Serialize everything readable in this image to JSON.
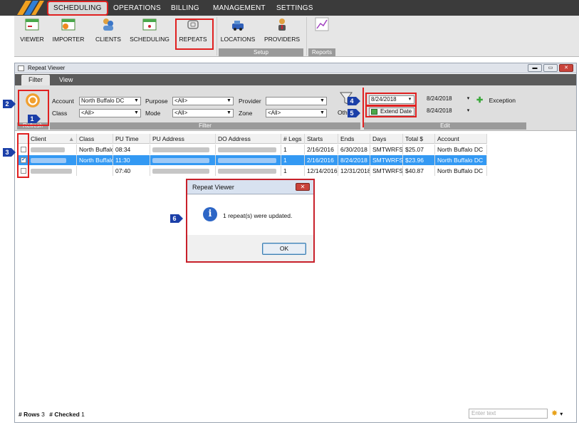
{
  "menu": {
    "items": [
      "SCHEDULING",
      "OPERATIONS",
      "BILLING",
      "MANAGEMENT",
      "SETTINGS"
    ]
  },
  "ribbon": {
    "buttons": [
      "VIEWER",
      "IMPORTER",
      "CLIENTS",
      "SCHEDULING",
      "REPEATS",
      "LOCATIONS",
      "PROVIDERS"
    ],
    "groups": {
      "setup": "Setup",
      "reports": "Reports"
    }
  },
  "window": {
    "title": "Repeat Viewer",
    "tabs": [
      "Filter",
      "View"
    ],
    "refresh_label": "Refresh",
    "filter_group_label": "Filter",
    "edit_group_label": "Edit",
    "fields": {
      "account_label": "Account",
      "account_value": "North Buffalo DC",
      "class_label": "Class",
      "class_value": "<All>",
      "purpose_label": "Purpose",
      "purpose_value": "<All>",
      "mode_label": "Mode",
      "mode_value": "<All>",
      "provider_label": "Provider",
      "provider_value": "",
      "zone_label": "Zone",
      "zone_value": "<All>",
      "other_label": "Other"
    },
    "edit": {
      "date1": "8/24/2018",
      "date2": "8/24/2018",
      "date3": "8/24/2018",
      "extend_label": "Extend Date",
      "exception_label": "Exception"
    }
  },
  "grid": {
    "headers": [
      "Client",
      "Class",
      "PU Time",
      "PU Address",
      "DO Address",
      "# Legs",
      "Starts",
      "Ends",
      "Days",
      "Total $",
      "Account"
    ],
    "rows": [
      {
        "checked": false,
        "class": "North Buffalo",
        "pu_time": "08:34",
        "legs": "1",
        "starts": "2/16/2016",
        "ends": "6/30/2018",
        "days": "SMTWRFS",
        "total": "$25.07",
        "account": "North Buffalo DC"
      },
      {
        "checked": true,
        "class": "North Buffalo",
        "pu_time": "11:30",
        "legs": "1",
        "starts": "2/16/2016",
        "ends": "8/24/2018",
        "days": "SMTWRFS",
        "total": "$23.96",
        "account": "North Buffalo DC"
      },
      {
        "checked": false,
        "class": "",
        "pu_time": "07:40",
        "legs": "1",
        "starts": "12/14/2016",
        "ends": "12/31/2018",
        "days": "SMTWRFS",
        "total": "$40.87",
        "account": "North Buffalo DC"
      }
    ]
  },
  "status": {
    "rows_label": "# Rows",
    "rows_count": "3",
    "checked_label": "# Checked",
    "checked_count": "1",
    "search_placeholder": "Enter text"
  },
  "dialog": {
    "title": "Repeat Viewer",
    "message": "1 repeat(s) were updated.",
    "ok_label": "OK",
    "icon": "info-icon"
  },
  "markers": [
    "1",
    "2",
    "3",
    "4",
    "5",
    "6"
  ],
  "colors": {
    "highlight": "#e02020",
    "selected_row": "#3399f3",
    "marker": "#1b3fa8"
  }
}
